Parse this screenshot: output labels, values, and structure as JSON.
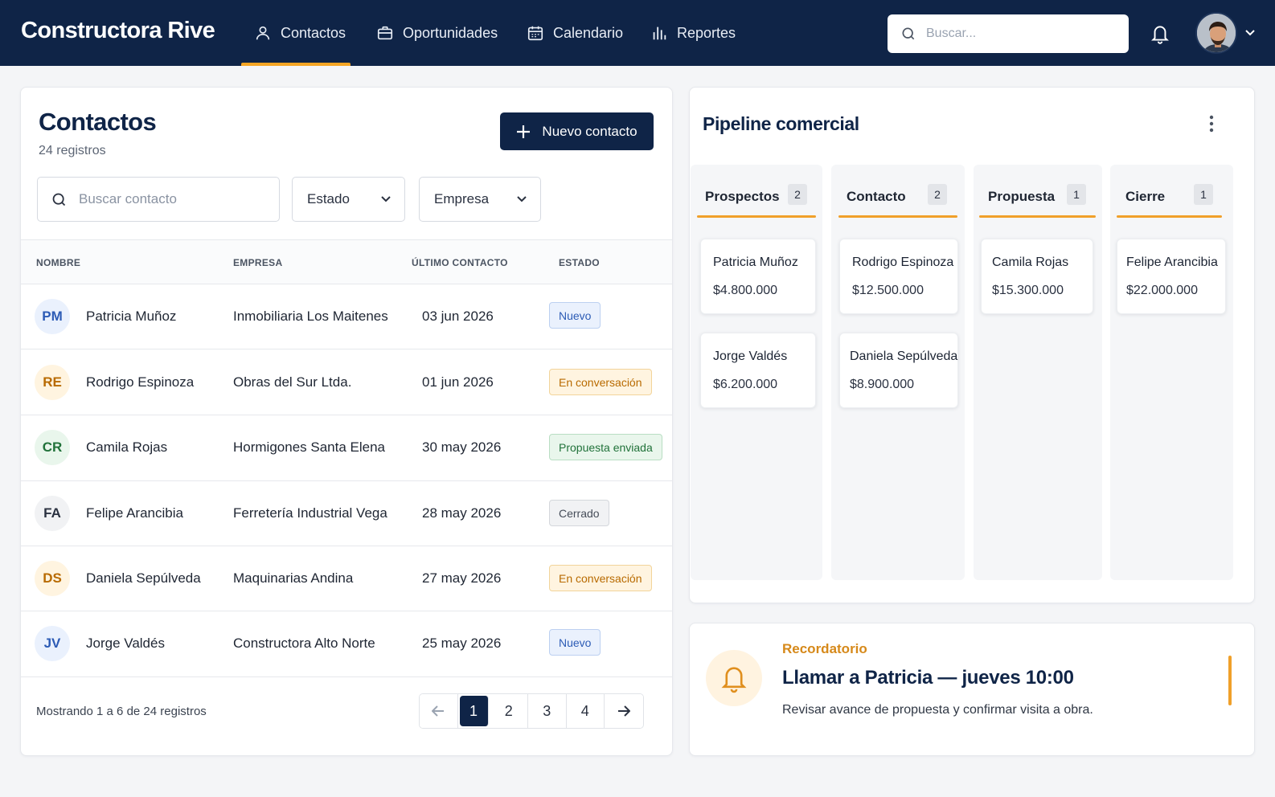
{
  "app": {
    "brand": "Constructora Rive"
  },
  "nav": [
    {
      "label": "Contactos",
      "icon": "user-icon",
      "active": true
    },
    {
      "label": "Oportunidades",
      "icon": "briefcase-icon",
      "active": false
    },
    {
      "label": "Calendario",
      "icon": "calendar-icon",
      "active": false
    },
    {
      "label": "Reportes",
      "icon": "bar-chart-icon",
      "active": false
    }
  ],
  "topbar": {
    "search_placeholder": "Buscar..."
  },
  "contacts": {
    "title": "Contactos",
    "count_label": "24 registros",
    "new_button": "Nuevo contacto",
    "search_placeholder": "Buscar contacto",
    "filter_estado": "Estado",
    "filter_empresa": "Empresa",
    "columns": [
      "NOMBRE",
      "EMPRESA",
      "ÚLTIMO CONTACTO",
      "ESTADO"
    ],
    "rows": [
      {
        "initials": "PM",
        "name": "Patricia Muñoz",
        "company": "Inmobiliaria Los Maitenes",
        "date": "03 jun 2026",
        "status": "Nuevo"
      },
      {
        "initials": "RE",
        "name": "Rodrigo Espinoza",
        "company": "Obras del Sur Ltda.",
        "date": "01 jun 2026",
        "status": "En conversación"
      },
      {
        "initials": "CR",
        "name": "Camila Rojas",
        "company": "Hormigones Santa Elena",
        "date": "30 may 2026",
        "status": "Propuesta enviada"
      },
      {
        "initials": "FA",
        "name": "Felipe Arancibia",
        "company": "Ferretería Industrial Vega",
        "date": "28 may 2026",
        "status": "Cerrado"
      },
      {
        "initials": "DS",
        "name": "Daniela Sepúlveda",
        "company": "Maquinarias Andina",
        "date": "27 may 2026",
        "status": "En conversación"
      },
      {
        "initials": "JV",
        "name": "Jorge Valdés",
        "company": "Constructora Alto Norte",
        "date": "25 may 2026",
        "status": "Nuevo"
      }
    ],
    "pagination_info": "Mostrando 1 a 6 de 24 registros",
    "pages": [
      "1",
      "2",
      "3",
      "4"
    ],
    "current_page": "1"
  },
  "pipeline": {
    "title": "Pipeline comercial",
    "columns": [
      {
        "name": "Prospectos",
        "count": "2",
        "deals": [
          {
            "name": "Patricia Muñoz",
            "value": "$4.800.000"
          },
          {
            "name": "Jorge Valdés",
            "value": "$6.200.000"
          }
        ]
      },
      {
        "name": "Contacto",
        "count": "2",
        "deals": [
          {
            "name": "Rodrigo Espinoza",
            "value": "$12.500.000"
          },
          {
            "name": "Daniela Sepúlveda",
            "value": "$8.900.000"
          }
        ]
      },
      {
        "name": "Propuesta",
        "count": "1",
        "deals": [
          {
            "name": "Camila Rojas",
            "value": "$15.300.000"
          }
        ]
      },
      {
        "name": "Cierre",
        "count": "1",
        "deals": [
          {
            "name": "Felipe Arancibia",
            "value": "$22.000.000"
          }
        ]
      }
    ]
  },
  "reminder": {
    "label": "Recordatorio",
    "title": "Llamar a Patricia — jueves 10:00",
    "description": "Revisar avance de propuesta y confirmar visita a obra."
  },
  "colors": {
    "navy": "#0f2447",
    "accent": "#f5a524",
    "status_nuevo": "#2c5bb5",
    "status_conversacion": "#b86a00",
    "status_propuesta": "#21723a",
    "status_cerrado": "#454c58"
  }
}
